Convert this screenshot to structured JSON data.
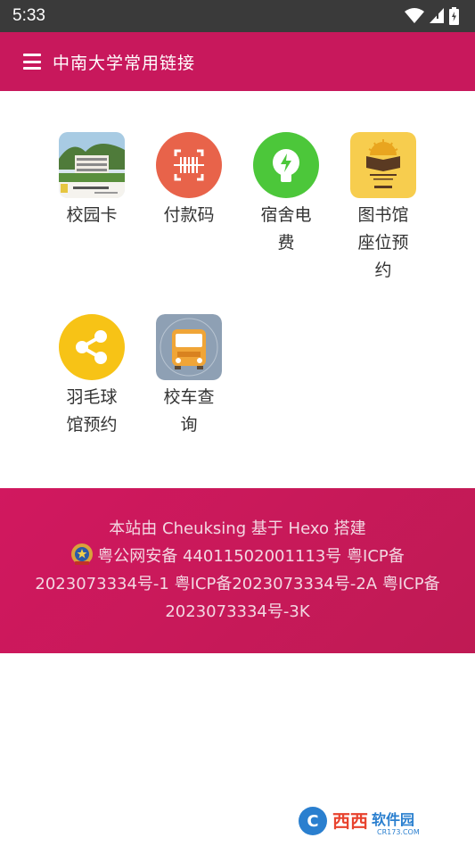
{
  "status": {
    "time": "5:33"
  },
  "app_bar": {
    "title": "中南大学常用链接"
  },
  "tiles": [
    {
      "label": "校园卡",
      "icon": "campus-card-icon"
    },
    {
      "label": "付款码",
      "icon": "payment-code-icon"
    },
    {
      "label": "宿舍电费",
      "icon": "electricity-icon"
    },
    {
      "label": "图书馆座位预约",
      "icon": "library-icon"
    },
    {
      "label": "羽毛球馆预约",
      "icon": "share-icon"
    },
    {
      "label": "校车查询",
      "icon": "bus-icon"
    }
  ],
  "footer": {
    "line1": "本站由 Cheuksing 基于 Hexo 搭建",
    "beian": "粤公网安备 44011502001113号 粤ICP备2023073334号-1 粤ICP备2023073334号-2A 粤ICP备2023073334号-3K"
  },
  "colors": {
    "primary": "#c8185c",
    "status_bar": "#3a3a3a",
    "label": "#333333"
  },
  "watermark": {
    "text": "西西软件园",
    "sub": "CR173.COM"
  }
}
